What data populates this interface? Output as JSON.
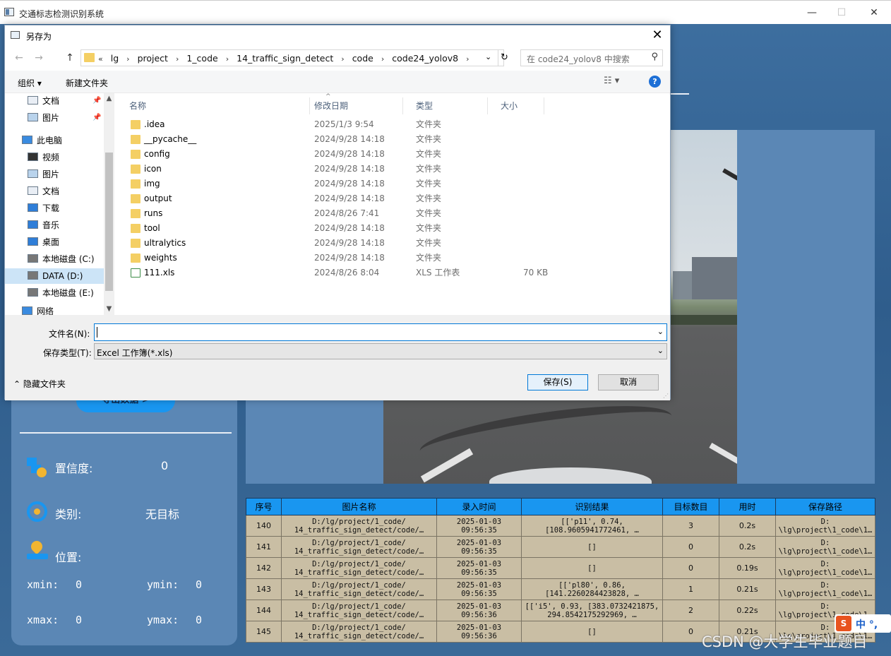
{
  "app": {
    "title": "交通标志检测识别系统",
    "minimize": "—",
    "maximize": "☐",
    "close": "✕"
  },
  "left_panel": {
    "export_label": "导出数据 >",
    "confidence_label": "置信度:",
    "confidence_value": "0",
    "category_label": "类别:",
    "category_value": "无目标",
    "position_label": "位置:",
    "xmin_label": "xmin:",
    "xmin_value": "0",
    "ymin_label": "ymin:",
    "ymin_value": "0",
    "xmax_label": "xmax:",
    "xmax_value": "0",
    "ymax_label": "ymax:",
    "ymax_value": "0"
  },
  "table": {
    "headers": [
      "序号",
      "图片名称",
      "录入时间",
      "识别结果",
      "目标数目",
      "用时",
      "保存路径"
    ],
    "rows": [
      {
        "id": "140",
        "name1": "D:/lg/project/1_code/",
        "name2": "14_traffic_sign_detect/code/…",
        "t1": "2025-01-03",
        "t2": "09:56:35",
        "r1": "[['p11', 0.74,",
        "r2": "[108.9605941772461, …",
        "count": "3",
        "time": "0.2s",
        "p1": "D:",
        "p2": "\\lg\\project\\1_code\\1…"
      },
      {
        "id": "141",
        "name1": "D:/lg/project/1_code/",
        "name2": "14_traffic_sign_detect/code/…",
        "t1": "2025-01-03",
        "t2": "09:56:35",
        "r1": "[]",
        "r2": "",
        "count": "0",
        "time": "0.2s",
        "p1": "D:",
        "p2": "\\lg\\project\\1_code\\1…"
      },
      {
        "id": "142",
        "name1": "D:/lg/project/1_code/",
        "name2": "14_traffic_sign_detect/code/…",
        "t1": "2025-01-03",
        "t2": "09:56:35",
        "r1": "[]",
        "r2": "",
        "count": "0",
        "time": "0.19s",
        "p1": "D:",
        "p2": "\\lg\\project\\1_code\\1…"
      },
      {
        "id": "143",
        "name1": "D:/lg/project/1_code/",
        "name2": "14_traffic_sign_detect/code/…",
        "t1": "2025-01-03",
        "t2": "09:56:35",
        "r1": "[['pl80', 0.86,",
        "r2": "[141.2260284423828, …",
        "count": "1",
        "time": "0.21s",
        "p1": "D:",
        "p2": "\\lg\\project\\1_code\\1…"
      },
      {
        "id": "144",
        "name1": "D:/lg/project/1_code/",
        "name2": "14_traffic_sign_detect/code/…",
        "t1": "2025-01-03",
        "t2": "09:56:36",
        "r1": "[['i5', 0.93, [383.0732421875,",
        "r2": "294.8542175292969, …",
        "count": "2",
        "time": "0.22s",
        "p1": "D:",
        "p2": "\\lg\\project\\1_code\\1…"
      },
      {
        "id": "145",
        "name1": "D:/lg/project/1_code/",
        "name2": "14_traffic_sign_detect/code/…",
        "t1": "2025-01-03",
        "t2": "09:56:36",
        "r1": "[]",
        "r2": "",
        "count": "0",
        "time": "0.21s",
        "p1": "D:",
        "p2": "\\lg\\project\\1_code\\1…"
      }
    ]
  },
  "watermark": "CSDN @大学生毕业题目",
  "ime": {
    "logo": "S",
    "text": "中 °,"
  },
  "dialog": {
    "title": "另存为",
    "close": "✕",
    "nav": {
      "back": "←",
      "forward": "→",
      "up": "↑",
      "refresh": "↻",
      "dropdown": "⌄"
    },
    "breadcrumbs": [
      "«",
      "lg",
      "›",
      "project",
      "›",
      "1_code",
      "›",
      "14_traffic_sign_detect",
      "›",
      "code",
      "›",
      "code24_yolov8",
      "›"
    ],
    "search_placeholder": "在 code24_yolov8 中搜索",
    "search_icon": "⚲",
    "toolbar": {
      "organize": "组织 ▾",
      "new_folder": "新建文件夹",
      "view": "☷ ▾",
      "help": "?"
    },
    "nav_pane": [
      {
        "label": "文档",
        "icon": "document-icon",
        "pinned": true,
        "selected": false
      },
      {
        "label": "图片",
        "icon": "pictures-icon",
        "pinned": true,
        "selected": false
      },
      {
        "label": "此电脑",
        "icon": "computer-icon",
        "pinned": false,
        "selected": false
      },
      {
        "label": "视频",
        "icon": "video-icon",
        "pinned": false,
        "selected": false
      },
      {
        "label": "图片",
        "icon": "pictures-icon",
        "pinned": false,
        "selected": false
      },
      {
        "label": "文档",
        "icon": "document-icon",
        "pinned": false,
        "selected": false
      },
      {
        "label": "下载",
        "icon": "download-icon",
        "pinned": false,
        "selected": false
      },
      {
        "label": "音乐",
        "icon": "music-icon",
        "pinned": false,
        "selected": false
      },
      {
        "label": "桌面",
        "icon": "desktop-icon",
        "pinned": false,
        "selected": false
      },
      {
        "label": "本地磁盘 (C:)",
        "icon": "drive-icon",
        "pinned": false,
        "selected": false
      },
      {
        "label": "DATA (D:)",
        "icon": "drive-icon",
        "pinned": false,
        "selected": true
      },
      {
        "label": "本地磁盘 (E:)",
        "icon": "drive-icon",
        "pinned": false,
        "selected": false
      },
      {
        "label": "网络",
        "icon": "network-icon",
        "pinned": false,
        "selected": false
      }
    ],
    "pin_glyph": "📌",
    "columns": {
      "name": "名称",
      "date": "修改日期",
      "type": "类型",
      "size": "大小",
      "sort": "^"
    },
    "files": [
      {
        "name": ".idea",
        "date": "2025/1/3 9:54",
        "type": "文件夹",
        "size": "",
        "kind": "folder"
      },
      {
        "name": "__pycache__",
        "date": "2024/9/28 14:18",
        "type": "文件夹",
        "size": "",
        "kind": "folder"
      },
      {
        "name": "config",
        "date": "2024/9/28 14:18",
        "type": "文件夹",
        "size": "",
        "kind": "folder"
      },
      {
        "name": "icon",
        "date": "2024/9/28 14:18",
        "type": "文件夹",
        "size": "",
        "kind": "folder"
      },
      {
        "name": "img",
        "date": "2024/9/28 14:18",
        "type": "文件夹",
        "size": "",
        "kind": "folder"
      },
      {
        "name": "output",
        "date": "2024/9/28 14:18",
        "type": "文件夹",
        "size": "",
        "kind": "folder"
      },
      {
        "name": "runs",
        "date": "2024/8/26 7:41",
        "type": "文件夹",
        "size": "",
        "kind": "folder"
      },
      {
        "name": "tool",
        "date": "2024/9/28 14:18",
        "type": "文件夹",
        "size": "",
        "kind": "folder"
      },
      {
        "name": "ultralytics",
        "date": "2024/9/28 14:18",
        "type": "文件夹",
        "size": "",
        "kind": "folder"
      },
      {
        "name": "weights",
        "date": "2024/9/28 14:18",
        "type": "文件夹",
        "size": "",
        "kind": "folder"
      },
      {
        "name": "111.xls",
        "date": "2024/8/26 8:04",
        "type": "XLS 工作表",
        "size": "70 KB",
        "kind": "xls"
      }
    ],
    "filename_label": "文件名(N):",
    "filename_value": "",
    "filetype_label": "保存类型(T):",
    "filetype_value": "Excel 工作簿(*.xls)",
    "hide_folders": "⌃ 隐藏文件夹",
    "save": "保存(S)",
    "cancel": "取消"
  }
}
